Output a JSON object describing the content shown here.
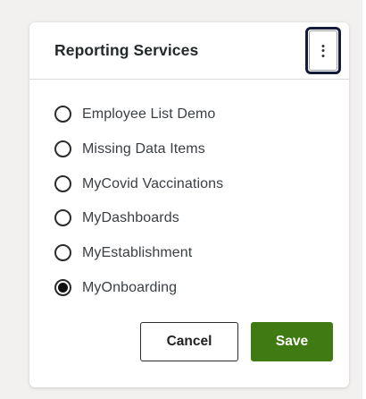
{
  "panel": {
    "title": "Reporting Services",
    "menu_icon": "kebab-vertical-icon"
  },
  "options": [
    {
      "label": "Employee List Demo",
      "selected": false
    },
    {
      "label": "Missing Data Items",
      "selected": false
    },
    {
      "label": "MyCovid Vaccinations",
      "selected": false
    },
    {
      "label": "MyDashboards",
      "selected": false
    },
    {
      "label": "MyEstablishment",
      "selected": false
    },
    {
      "label": "MyOnboarding",
      "selected": true
    }
  ],
  "actions": {
    "cancel_label": "Cancel",
    "save_label": "Save"
  },
  "colors": {
    "save_background": "#3f7b12",
    "menu_focus_ring": "#141a3a",
    "page_background": "#f2f1f0"
  }
}
